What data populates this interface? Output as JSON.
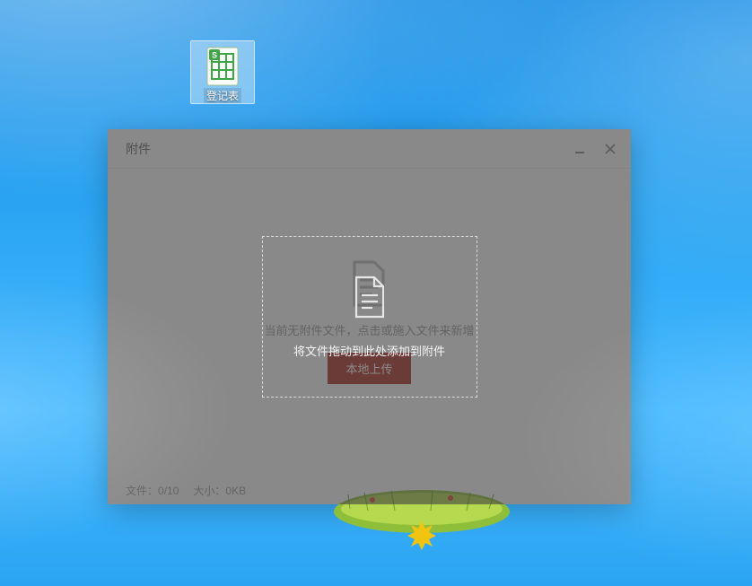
{
  "desktop": {
    "file": {
      "label": "登记表",
      "icon_name": "spreadsheet-file-icon"
    }
  },
  "dialog": {
    "title": "附件",
    "empty_message": "当前无附件文件，点击或施入文件来新增",
    "primary_button_label": "本地上传",
    "footer": {
      "files_label": "文件：",
      "files_value": "0/10",
      "size_label": "大小：",
      "size_value": "0KB"
    }
  },
  "overlay": {
    "drop_hint": "将文件拖动到此处添加到附件"
  },
  "colors": {
    "accent_primary": "#b1322a",
    "desktop_blue_top": "#1a8fe6",
    "desktop_blue_bottom": "#46b9ff"
  },
  "window_controls": {
    "minimize": "minimize",
    "close": "close"
  }
}
